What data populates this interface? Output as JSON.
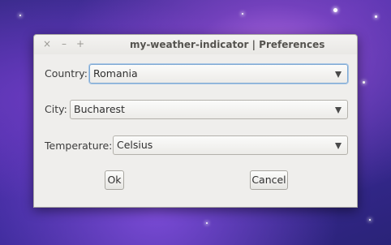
{
  "window": {
    "title": "my-weather-indicator | Preferences",
    "close_glyph": "×",
    "minimize_glyph": "–",
    "maximize_glyph": "+"
  },
  "form": {
    "country_label": "Country:",
    "country_value": "Romania",
    "city_label": "City:",
    "city_value": "Bucharest",
    "temperature_label": "Temperature:",
    "temperature_value": "Celsius"
  },
  "buttons": {
    "ok_label": "Ok",
    "cancel_label": "Cancel"
  },
  "colors": {
    "focus_ring": "#7fa9d3",
    "dialog_bg": "#efeeec"
  },
  "icons": [
    "close-icon",
    "minimize-icon",
    "maximize-icon",
    "dropdown-arrow-icon"
  ]
}
